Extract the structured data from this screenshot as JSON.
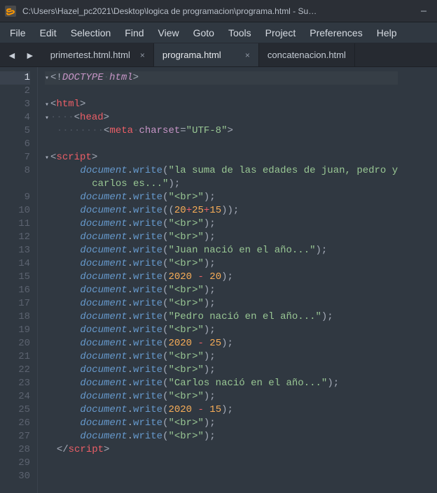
{
  "titlebar": {
    "title": "C:\\Users\\Hazel_pc2021\\Desktop\\logica de programacion\\programa.html - Su…"
  },
  "menu": {
    "items": [
      "File",
      "Edit",
      "Selection",
      "Find",
      "View",
      "Goto",
      "Tools",
      "Project",
      "Preferences",
      "Help"
    ]
  },
  "tabs": {
    "nav_back": "◄",
    "nav_fwd": "►",
    "items": [
      {
        "label": "primertest.html.html",
        "active": false,
        "closeable": true
      },
      {
        "label": "programa.html",
        "active": true,
        "closeable": true
      },
      {
        "label": "concatenacion.html",
        "active": false,
        "closeable": false
      }
    ],
    "close_glyph": "×"
  },
  "code": {
    "lines": [
      {
        "n": 1,
        "html": "<span class='c-punc'>&lt;!</span><span class='c-doct'>DOCTYPE</span><span class='c-ws'>·</span><span class='c-doctkw'>html</span><span class='c-punc'>&gt;</span>",
        "indent": 1,
        "fold": true,
        "cursor": true
      },
      {
        "n": 2,
        "html": "",
        "indent": 0
      },
      {
        "n": 3,
        "html": "<span class='c-punc'>&lt;</span><span class='c-tag'>html</span><span class='c-punc'>&gt;</span>",
        "indent": 1,
        "fold": true
      },
      {
        "n": 4,
        "html": "<span class='c-ws'>····</span><span class='c-punc'>&lt;</span><span class='c-tag'>head</span><span class='c-punc'>&gt;</span>",
        "indent": 2,
        "fold": true
      },
      {
        "n": 5,
        "html": "<span class='c-ws'>········</span><span class='c-punc'>&lt;</span><span class='c-tag'>meta</span><span class='c-ws'>·</span><span class='c-attr'>charset</span><span class='c-punc'>=</span><span class='c-str'>\"UTF-8\"</span><span class='c-punc'>&gt;</span>",
        "indent": 3
      },
      {
        "n": 6,
        "html": "",
        "indent": 0
      },
      {
        "n": 7,
        "html": "<span class='c-punc'>&lt;</span><span class='c-tag'>script</span><span class='c-punc'>&gt;</span>",
        "indent": 0,
        "fold": true
      },
      {
        "n": 8,
        "html": "    <span class='c-obj'>document</span><span class='c-punc'>.</span><span class='c-fn'>write</span><span class='c-punc'>(</span><span class='c-str'>\"la suma de las edades de juan, pedro y<br>        carlos es...\"</span><span class='c-punc'>);</span>",
        "indent": 1,
        "double": true
      },
      {
        "n": 9,
        "html": "    <span class='c-obj'>document</span><span class='c-punc'>.</span><span class='c-fn'>write</span><span class='c-punc'>(</span><span class='c-str'>\"&lt;br&gt;\"</span><span class='c-punc'>);</span>",
        "indent": 1
      },
      {
        "n": 10,
        "html": "    <span class='c-obj'>document</span><span class='c-punc'>.</span><span class='c-fn'>write</span><span class='c-punc'>((</span><span class='c-num'>20</span><span class='c-op'>+</span><span class='c-num'>25</span><span class='c-op'>+</span><span class='c-num'>15</span><span class='c-punc'>));</span>",
        "indent": 1
      },
      {
        "n": 11,
        "html": "    <span class='c-obj'>document</span><span class='c-punc'>.</span><span class='c-fn'>write</span><span class='c-punc'>(</span><span class='c-str'>\"&lt;br&gt;\"</span><span class='c-punc'>);</span>",
        "indent": 1
      },
      {
        "n": 12,
        "html": "    <span class='c-obj'>document</span><span class='c-punc'>.</span><span class='c-fn'>write</span><span class='c-punc'>(</span><span class='c-str'>\"&lt;br&gt;\"</span><span class='c-punc'>);</span>",
        "indent": 1
      },
      {
        "n": 13,
        "html": "    <span class='c-obj'>document</span><span class='c-punc'>.</span><span class='c-fn'>write</span><span class='c-punc'>(</span><span class='c-str'>\"Juan nació en el año...\"</span><span class='c-punc'>);</span>",
        "indent": 1
      },
      {
        "n": 14,
        "html": "    <span class='c-obj'>document</span><span class='c-punc'>.</span><span class='c-fn'>write</span><span class='c-punc'>(</span><span class='c-str'>\"&lt;br&gt;\"</span><span class='c-punc'>);</span>",
        "indent": 1
      },
      {
        "n": 15,
        "html": "    <span class='c-obj'>document</span><span class='c-punc'>.</span><span class='c-fn'>write</span><span class='c-punc'>(</span><span class='c-num'>2020</span> <span class='c-op'>-</span> <span class='c-num'>20</span><span class='c-punc'>);</span>",
        "indent": 1
      },
      {
        "n": 16,
        "html": "    <span class='c-obj'>document</span><span class='c-punc'>.</span><span class='c-fn'>write</span><span class='c-punc'>(</span><span class='c-str'>\"&lt;br&gt;\"</span><span class='c-punc'>);</span>",
        "indent": 1
      },
      {
        "n": 17,
        "html": "    <span class='c-obj'>document</span><span class='c-punc'>.</span><span class='c-fn'>write</span><span class='c-punc'>(</span><span class='c-str'>\"&lt;br&gt;\"</span><span class='c-punc'>);</span>",
        "indent": 1
      },
      {
        "n": 18,
        "html": "    <span class='c-obj'>document</span><span class='c-punc'>.</span><span class='c-fn'>write</span><span class='c-punc'>(</span><span class='c-str'>\"Pedro nació en el año...\"</span><span class='c-punc'>);</span>",
        "indent": 1
      },
      {
        "n": 19,
        "html": "    <span class='c-obj'>document</span><span class='c-punc'>.</span><span class='c-fn'>write</span><span class='c-punc'>(</span><span class='c-str'>\"&lt;br&gt;\"</span><span class='c-punc'>);</span>",
        "indent": 1
      },
      {
        "n": 20,
        "html": "    <span class='c-obj'>document</span><span class='c-punc'>.</span><span class='c-fn'>write</span><span class='c-punc'>(</span><span class='c-num'>2020</span> <span class='c-op'>-</span> <span class='c-num'>25</span><span class='c-punc'>);</span>",
        "indent": 1
      },
      {
        "n": 21,
        "html": "    <span class='c-obj'>document</span><span class='c-punc'>.</span><span class='c-fn'>write</span><span class='c-punc'>(</span><span class='c-str'>\"&lt;br&gt;\"</span><span class='c-punc'>);</span>",
        "indent": 1
      },
      {
        "n": 22,
        "html": "    <span class='c-obj'>document</span><span class='c-punc'>.</span><span class='c-fn'>write</span><span class='c-punc'>(</span><span class='c-str'>\"&lt;br&gt;\"</span><span class='c-punc'>);</span>",
        "indent": 1
      },
      {
        "n": 23,
        "html": "    <span class='c-obj'>document</span><span class='c-punc'>.</span><span class='c-fn'>write</span><span class='c-punc'>(</span><span class='c-str'>\"Carlos nació en el año...\"</span><span class='c-punc'>);</span>",
        "indent": 1
      },
      {
        "n": 24,
        "html": "    <span class='c-obj'>document</span><span class='c-punc'>.</span><span class='c-fn'>write</span><span class='c-punc'>(</span><span class='c-str'>\"&lt;br&gt;\"</span><span class='c-punc'>);</span>",
        "indent": 1
      },
      {
        "n": 25,
        "html": "    <span class='c-obj'>document</span><span class='c-punc'>.</span><span class='c-fn'>write</span><span class='c-punc'>(</span><span class='c-num'>2020</span> <span class='c-op'>-</span> <span class='c-num'>15</span><span class='c-punc'>);</span>",
        "indent": 1
      },
      {
        "n": 26,
        "html": "    <span class='c-obj'>document</span><span class='c-punc'>.</span><span class='c-fn'>write</span><span class='c-punc'>(</span><span class='c-str'>\"&lt;br&gt;\"</span><span class='c-punc'>);</span>",
        "indent": 1
      },
      {
        "n": 27,
        "html": "    <span class='c-obj'>document</span><span class='c-punc'>.</span><span class='c-fn'>write</span><span class='c-punc'>(</span><span class='c-str'>\"&lt;br&gt;\"</span><span class='c-punc'>);</span>",
        "indent": 1
      },
      {
        "n": 28,
        "html": "<span class='c-punc'>&lt;/</span><span class='c-tag'>script</span><span class='c-punc'>&gt;</span>",
        "indent": 0
      },
      {
        "n": 29,
        "html": "",
        "indent": 0
      },
      {
        "n": 30,
        "html": "",
        "indent": 0
      }
    ]
  }
}
